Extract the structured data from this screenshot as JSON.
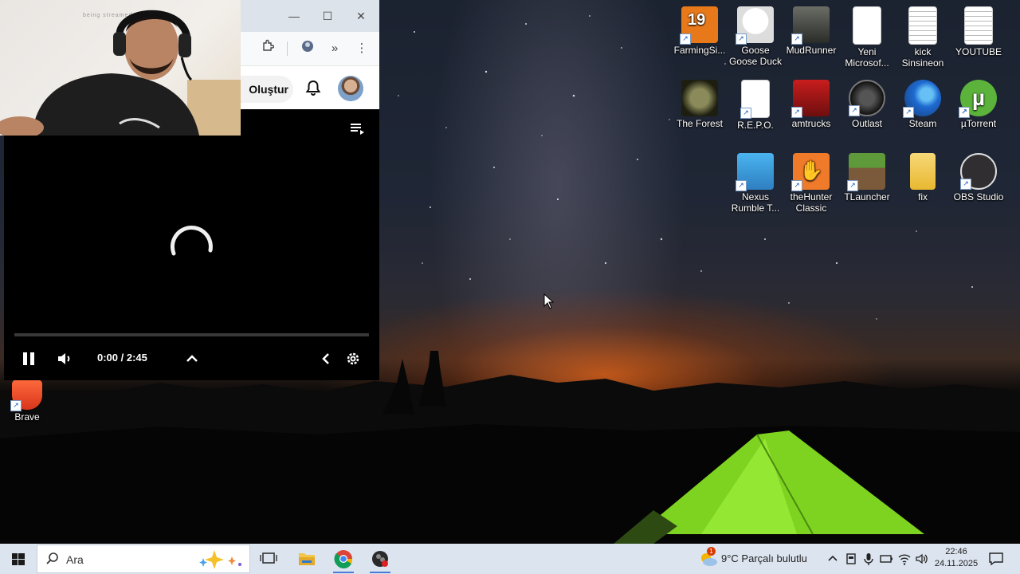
{
  "webcam": {
    "overlay_text": "being streamed app"
  },
  "browser": {
    "window_controls": {
      "minimize": "—",
      "maximize": "☐",
      "close": "✕"
    },
    "create_button_label": "Oluştur"
  },
  "player": {
    "time_display": "0:00 / 2:45",
    "state": "loading",
    "progress_fraction": 0
  },
  "desktop": {
    "icons_top": [
      {
        "label": "FarmingSi...",
        "icon": "farming-simulator-icon",
        "color": "#e8791a",
        "badge": "19"
      },
      {
        "label": "Goose Goose Duck",
        "icon": "goose-goose-duck-icon",
        "color": "#f4f4f4"
      },
      {
        "label": "MudRunner",
        "icon": "mudrunner-icon",
        "color": "#4c4f4a"
      },
      {
        "label": "Yeni Microsof...",
        "icon": "document-icon",
        "color": "#ffffff"
      },
      {
        "label": "kick Sinsineon",
        "icon": "text-file-icon",
        "color": "#ffffff"
      },
      {
        "label": "YOUTUBE",
        "icon": "text-file-icon",
        "color": "#ffffff"
      },
      {
        "label": "The Forest",
        "icon": "the-forest-icon",
        "color": "#4a4a2e"
      },
      {
        "label": "R.E.P.O.",
        "icon": "blank-file-icon",
        "color": "#ffffff"
      },
      {
        "label": "amtrucks",
        "icon": "american-truck-icon",
        "color": "#c91d1d"
      },
      {
        "label": "Outlast",
        "icon": "outlast-icon",
        "color": "#2a2a2a"
      },
      {
        "label": "Steam",
        "icon": "steam-icon",
        "color": "#1e6ad1"
      },
      {
        "label": "µTorrent",
        "icon": "utorrent-icon",
        "color": "#5bb33c"
      },
      {
        "label": "Nexus Rumble T...",
        "icon": "nexus-rumble-icon",
        "color": "#3aa0e0"
      },
      {
        "label": "theHunter Classic",
        "icon": "thehunter-icon",
        "color": "#ee7a2a"
      },
      {
        "label": "TLauncher",
        "icon": "tlauncher-icon",
        "color": "#5f9a3a"
      },
      {
        "label": "fix",
        "icon": "folder-icon",
        "color": "#f2c648"
      },
      {
        "label": "OBS Studio",
        "icon": "obs-studio-icon",
        "color": "#302e31"
      }
    ],
    "icon_brave": {
      "label": "Brave",
      "icon": "brave-icon",
      "color": "#fb542b"
    }
  },
  "taskbar": {
    "search_placeholder": "Ara",
    "weather_notification_count": "1",
    "weather_text": "9°C  Parçalı bulutlu",
    "time": "22:46",
    "date": "24.11.2025",
    "accent": "#dce4ef"
  }
}
